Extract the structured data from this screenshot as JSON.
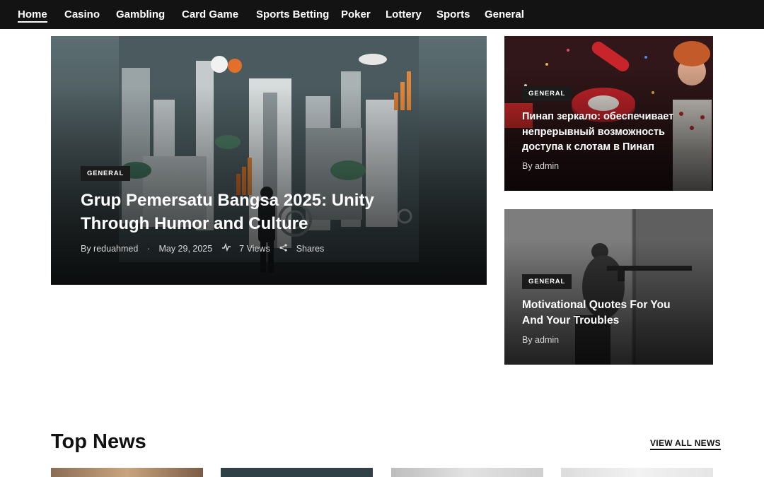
{
  "nav": {
    "items": [
      {
        "label": "Home"
      },
      {
        "label": "Casino"
      },
      {
        "label": "Gambling"
      },
      {
        "label": "Card Game"
      },
      {
        "label": "Sports Betting"
      },
      {
        "label": "Poker"
      },
      {
        "label": "Lottery"
      },
      {
        "label": "Sports"
      },
      {
        "label": "General"
      }
    ]
  },
  "featured": {
    "category": "GENERAL",
    "title": "Grup Pemersatu Bangsa 2025: Unity Through Humor and Culture",
    "author": "By reduahmed",
    "date": "May 29, 2025",
    "views": "7 Views",
    "shares": "Shares"
  },
  "side_posts": [
    {
      "category": "GENERAL",
      "title": "Пинап зеркало: обеспечивает непрерывный возможность доступа к слотам в Пинап",
      "author": "By admin"
    },
    {
      "category": "GENERAL",
      "title": "Motivational Quotes For You And Your Troubles",
      "author": "By admin"
    }
  ],
  "top_news": {
    "heading": "Top News",
    "view_all": "VIEW ALL NEWS"
  }
}
